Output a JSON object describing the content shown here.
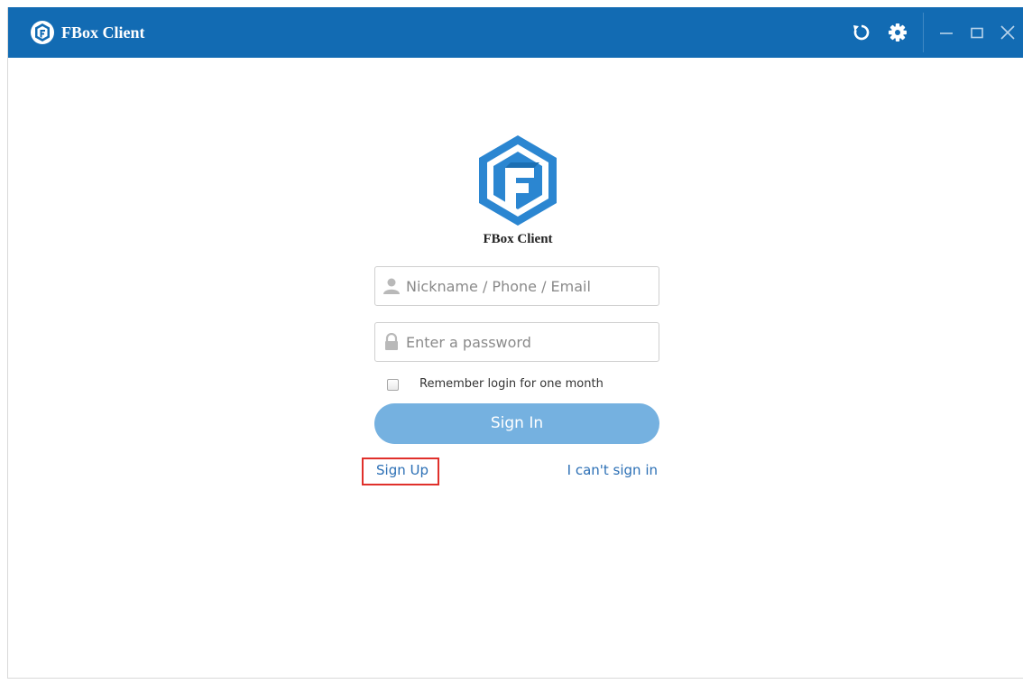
{
  "window": {
    "title": "FBox Client",
    "accent_color": "#126bb3",
    "logo_icon": "fbox-logo-icon"
  },
  "titlebar_controls": {
    "refresh_icon": "refresh-icon",
    "settings_icon": "gear-icon",
    "minimize_icon": "minimize-icon",
    "maximize_icon": "maximize-icon",
    "close_icon": "close-icon"
  },
  "login": {
    "brand_name": "FBox Client",
    "username_placeholder": "Nickname / Phone / Email",
    "username_value": "",
    "password_placeholder": "Enter a password",
    "password_value": "",
    "remember_label": "Remember login for one month",
    "remember_checked": false,
    "signin_label": "Sign In",
    "signin_color": "#75b1e0",
    "signup_label": "Sign Up",
    "cant_signin_label": "I can't sign in",
    "link_color": "#2b6fb5",
    "highlight_color": "#e0302b"
  }
}
